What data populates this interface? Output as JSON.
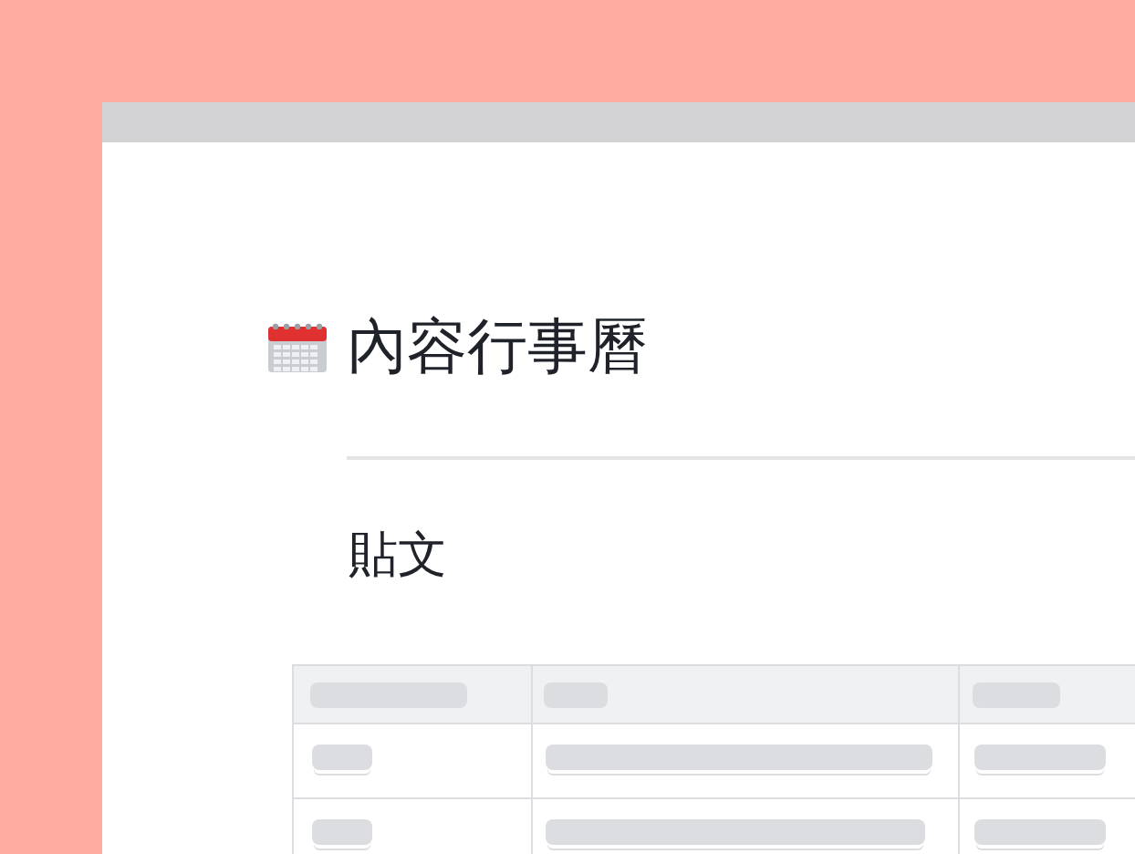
{
  "page": {
    "title": "內容行事曆"
  },
  "section": {
    "heading": "貼文"
  },
  "table": {
    "loading": true
  }
}
